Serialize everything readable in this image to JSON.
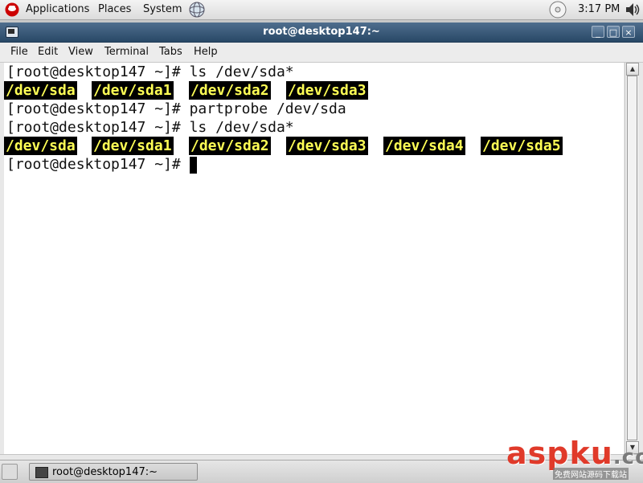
{
  "top_panel": {
    "menus": [
      "Applications",
      "Places",
      "System"
    ],
    "clock": "3:17 PM"
  },
  "window": {
    "title": "root@desktop147:~",
    "buttons": {
      "minimize": "_",
      "maximize": "□",
      "close": "×"
    },
    "menu": [
      "File",
      "Edit",
      "View",
      "Terminal",
      "Tabs",
      "Help"
    ]
  },
  "terminal": {
    "prompt": "[root@desktop147 ~]#",
    "lines": [
      {
        "type": "cmd",
        "command": "ls /dev/sda*"
      },
      {
        "type": "output",
        "items": [
          "/dev/sda",
          "/dev/sda1",
          "/dev/sda2",
          "/dev/sda3"
        ]
      },
      {
        "type": "cmd",
        "command": "partprobe /dev/sda"
      },
      {
        "type": "cmd",
        "command": "ls /dev/sda*"
      },
      {
        "type": "output",
        "items": [
          "/dev/sda",
          "/dev/sda1",
          "/dev/sda2",
          "/dev/sda3",
          "/dev/sda4",
          "/dev/sda5"
        ]
      },
      {
        "type": "cmd",
        "command": ""
      }
    ],
    "colors": {
      "background": "#ffffff",
      "text": "#111111",
      "highlight_bg": "#000000",
      "highlight_fg": "#ffff55"
    }
  },
  "taskbar": {
    "task_label": "root@desktop147:~"
  },
  "watermark": {
    "text_main": "aspku",
    "text_dot": ".com",
    "text_sub": "免费网站源码下载站"
  },
  "icons": {
    "logo": "redhat-logo-icon",
    "system_extra": "network-globe-icon",
    "cd": "cd-drive-icon",
    "volume": "volume-icon"
  }
}
